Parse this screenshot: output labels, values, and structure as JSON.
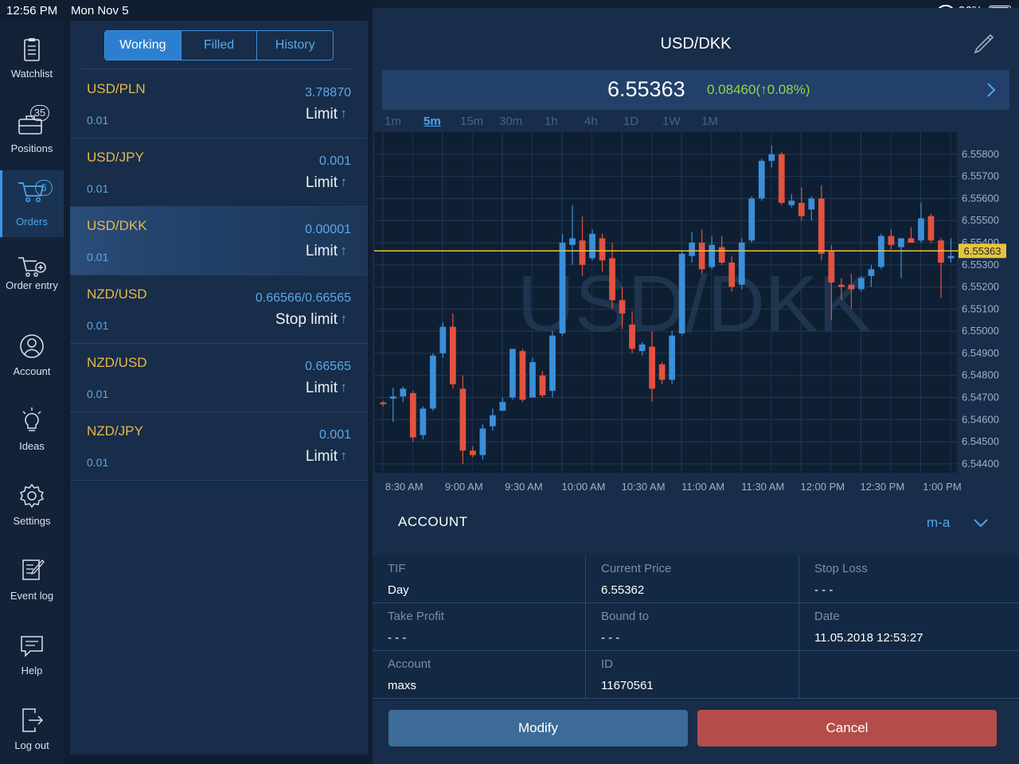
{
  "status_bar": {
    "time": "12:56 PM",
    "date": "Mon Nov 5",
    "battery": "96%"
  },
  "nav": {
    "items": [
      {
        "label": "Watchlist"
      },
      {
        "label": "Positions",
        "badge": "35"
      },
      {
        "label": "Orders",
        "badge": "6",
        "active": true
      },
      {
        "label": "Order entry"
      },
      {
        "label": "Account"
      },
      {
        "label": "Ideas"
      },
      {
        "label": "Settings"
      },
      {
        "label": "Event log"
      },
      {
        "label": "Help"
      },
      {
        "label": "Log out"
      }
    ]
  },
  "orders": {
    "tabs": [
      "Working",
      "Filled",
      "History"
    ],
    "active_tab": "Working",
    "rows": [
      {
        "symbol": "USD/PLN",
        "price": "3.78870",
        "qty": "0.01",
        "type": "Limit",
        "arrow": "↑"
      },
      {
        "symbol": "USD/JPY",
        "price": "0.001",
        "qty": "0.01",
        "type": "Limit",
        "arrow": "↑"
      },
      {
        "symbol": "USD/DKK",
        "price": "0.00001",
        "qty": "0.01",
        "type": "Limit",
        "arrow": "↑",
        "selected": true
      },
      {
        "symbol": "NZD/USD",
        "price": "0.66566/0.66565",
        "qty": "0.01",
        "type": "Stop limit",
        "arrow": "↑"
      },
      {
        "symbol": "NZD/USD",
        "price": "0.66565",
        "qty": "0.01",
        "type": "Limit",
        "arrow": "↑"
      },
      {
        "symbol": "NZD/JPY",
        "price": "0.001",
        "qty": "0.01",
        "type": "Limit",
        "arrow": "↑"
      }
    ]
  },
  "detail": {
    "symbol": "USD/DKK",
    "last": "6.55363",
    "change": "0.08460(↑0.08%)",
    "timeframes": [
      "1m",
      "5m",
      "15m",
      "30m",
      "1h",
      "4h",
      "1D",
      "1W",
      "1M"
    ],
    "active_timeframe": "5m"
  },
  "chart_data": {
    "type": "candlestick",
    "watermark": "USD/DKK",
    "x_labels": [
      "8:30 AM",
      "9:00 AM",
      "9:30 AM",
      "10:00 AM",
      "10:30 AM",
      "11:00 AM",
      "11:30 AM",
      "12:00 PM",
      "12:30 PM",
      "1:00 PM"
    ],
    "y_labels": [
      "6.55800",
      "6.55700",
      "6.55600",
      "6.55500",
      "6.55400",
      "6.55300",
      "6.55200",
      "6.55100",
      "6.55000",
      "6.54900",
      "6.54800",
      "6.54700",
      "6.54600",
      "6.54500",
      "6.54400"
    ],
    "ylim": [
      6.5436,
      6.559
    ],
    "current_price": 6.55363,
    "current_price_label": "6.55363",
    "up_color": "#3b8fd9",
    "down_color": "#e2523f",
    "price_line_color": "#e8c43a",
    "candles": [
      [
        6.54678,
        6.54685,
        6.5466,
        6.5467
      ],
      [
        6.54695,
        6.54745,
        6.5459,
        6.54705
      ],
      [
        6.54705,
        6.5475,
        6.5468,
        6.5474
      ],
      [
        6.5472,
        6.5473,
        6.545,
        6.5452
      ],
      [
        6.5453,
        6.5466,
        6.5451,
        6.5465
      ],
      [
        6.5465,
        6.549,
        6.5464,
        6.5489
      ],
      [
        6.549,
        6.5504,
        6.5488,
        6.5502
      ],
      [
        6.5502,
        6.5508,
        6.5474,
        6.5476
      ],
      [
        6.5474,
        6.548,
        6.544,
        6.5446
      ],
      [
        6.5446,
        6.5448,
        6.5443,
        6.5444
      ],
      [
        6.5444,
        6.5458,
        6.5442,
        6.5456
      ],
      [
        6.5457,
        6.5465,
        6.5455,
        6.5462
      ],
      [
        6.5464,
        6.547,
        6.5464,
        6.5468
      ],
      [
        6.547,
        6.5492,
        6.5469,
        6.5492
      ],
      [
        6.5491,
        6.5492,
        6.5468,
        6.5469
      ],
      [
        6.547,
        6.5488,
        6.547,
        6.5486
      ],
      [
        6.548,
        6.5482,
        6.547,
        6.5471
      ],
      [
        6.5473,
        6.55,
        6.547,
        6.5498
      ],
      [
        6.5499,
        6.5544,
        6.5498,
        6.554
      ],
      [
        6.5539,
        6.5557,
        6.553,
        6.5542
      ],
      [
        6.5541,
        6.5552,
        6.5525,
        6.553
      ],
      [
        6.5533,
        6.5546,
        6.5532,
        6.5544
      ],
      [
        6.5542,
        6.5544,
        6.5527,
        6.5532
      ],
      [
        6.5533,
        6.554,
        6.551,
        6.5514
      ],
      [
        6.5514,
        6.552,
        6.5501,
        6.5508
      ],
      [
        6.5503,
        6.5509,
        6.549,
        6.5492
      ],
      [
        6.5491,
        6.5495,
        6.5489,
        6.5494
      ],
      [
        6.5493,
        6.55,
        6.5468,
        6.5474
      ],
      [
        6.5485,
        6.5486,
        6.5476,
        6.5478
      ],
      [
        6.5478,
        6.55,
        6.5476,
        6.5498
      ],
      [
        6.5499,
        6.5536,
        6.5498,
        6.5535
      ],
      [
        6.5534,
        6.5545,
        6.5531,
        6.554
      ],
      [
        6.554,
        6.5546,
        6.5526,
        6.5528
      ],
      [
        6.5529,
        6.5543,
        6.5528,
        6.5539
      ],
      [
        6.5538,
        6.5543,
        6.553,
        6.5531
      ],
      [
        6.5531,
        6.5534,
        6.5518,
        6.552
      ],
      [
        6.5521,
        6.5542,
        6.5519,
        6.554
      ],
      [
        6.5541,
        6.5561,
        6.554,
        6.556
      ],
      [
        6.556,
        6.5578,
        6.5559,
        6.5577
      ],
      [
        6.5577,
        6.5584,
        6.5574,
        6.558
      ],
      [
        6.558,
        6.5581,
        6.5557,
        6.5558
      ],
      [
        6.5557,
        6.5562,
        6.5556,
        6.5559
      ],
      [
        6.5558,
        6.5565,
        6.555,
        6.5552
      ],
      [
        6.5555,
        6.5561,
        6.555,
        6.556
      ],
      [
        6.556,
        6.5566,
        6.5532,
        6.5535
      ],
      [
        6.5536,
        6.5539,
        6.5505,
        6.5522
      ],
      [
        6.5521,
        6.5524,
        6.5514,
        6.552
      ],
      [
        6.5521,
        6.5526,
        6.551,
        6.5519
      ],
      [
        6.5519,
        6.5525,
        6.5518,
        6.5524
      ],
      [
        6.5525,
        6.553,
        6.552,
        6.5528
      ],
      [
        6.5529,
        6.5544,
        6.5528,
        6.5543
      ],
      [
        6.5543,
        6.5546,
        6.5537,
        6.5539
      ],
      [
        6.5538,
        6.5542,
        6.5524,
        6.5542
      ],
      [
        6.5542,
        6.5547,
        6.554,
        6.554
      ],
      [
        6.5541,
        6.5558,
        6.554,
        6.5551
      ],
      [
        6.5552,
        6.5553,
        6.554,
        6.5541
      ],
      [
        6.5541,
        6.5542,
        6.5515,
        6.5531
      ],
      [
        6.5533,
        6.5542,
        6.5531,
        6.5534
      ]
    ]
  },
  "account": {
    "label": "ACCOUNT",
    "value": "m-a"
  },
  "fields": [
    {
      "key": "TIF",
      "value": "Day"
    },
    {
      "key": "Current Price",
      "value": "6.55362"
    },
    {
      "key": "Stop Loss",
      "value": "- - -"
    },
    {
      "key": "Take Profit",
      "value": "- - -"
    },
    {
      "key": "Bound to",
      "value": "- - -"
    },
    {
      "key": "Date",
      "value": "11.05.2018 12:53:27"
    },
    {
      "key": "Account",
      "value": "maxs"
    },
    {
      "key": "ID",
      "value": "11670561"
    },
    {
      "key": "",
      "value": ""
    }
  ],
  "buttons": {
    "modify": "Modify",
    "cancel": "Cancel"
  }
}
